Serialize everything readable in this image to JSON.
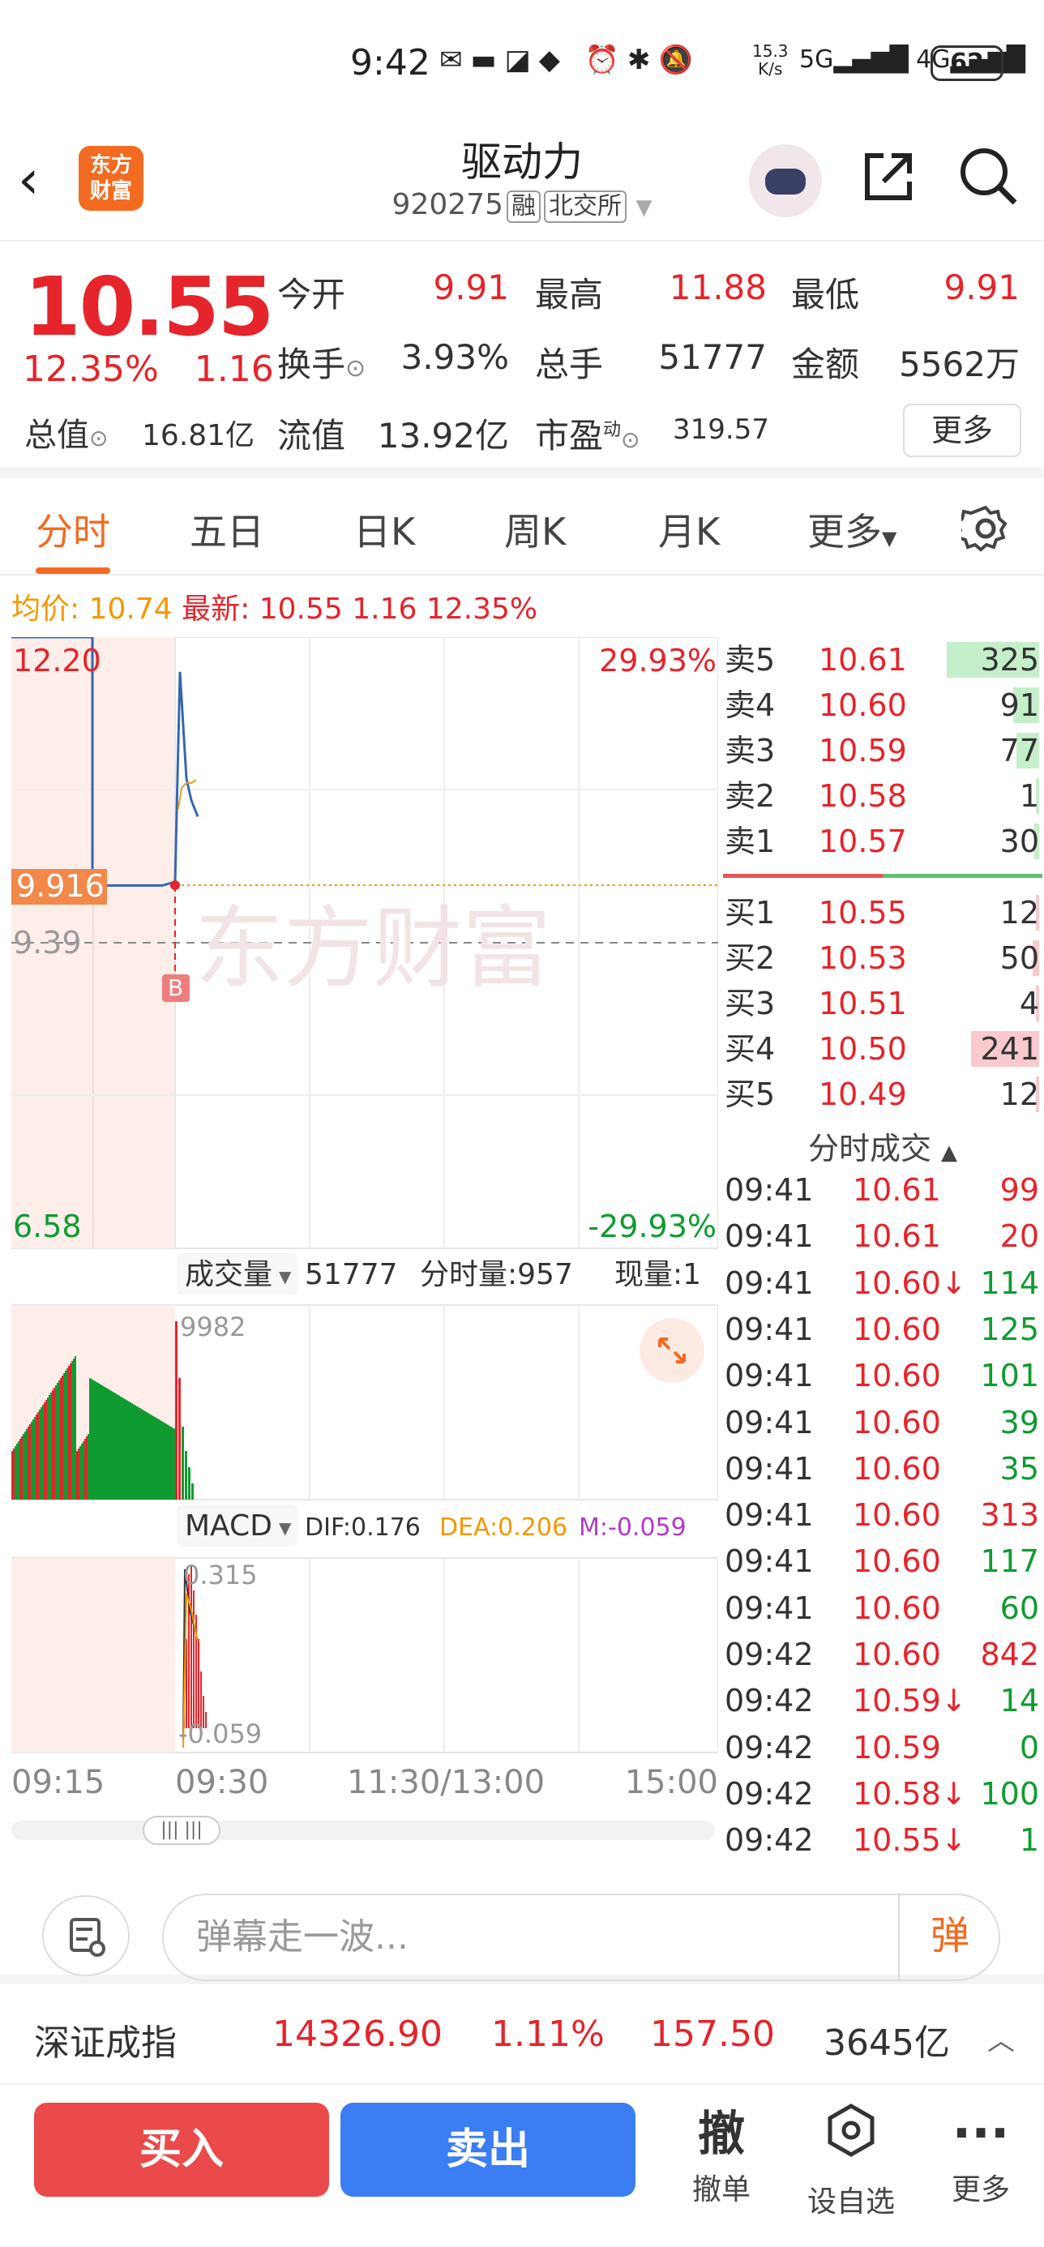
{
  "status_bar": {
    "time": "9:42",
    "net_speed_top": "15.3",
    "net_speed_bottom": "K/s",
    "signal1": "5G",
    "signal2": "4G",
    "battery": "62"
  },
  "header": {
    "title": "驱动力",
    "code": "920275",
    "tag1": "融",
    "tag2": "北交所",
    "logo_line1": "东方",
    "logo_line2": "财富"
  },
  "quote": {
    "price": "10.55",
    "change_pct": "12.35%",
    "change": "1.16",
    "open_label": "今开",
    "open": "9.91",
    "high_label": "最高",
    "high": "11.88",
    "low_label": "最低",
    "low": "9.91",
    "turnover_label": "换手",
    "turnover": "3.93%",
    "volume_label": "总手",
    "volume": "51777",
    "amount_label": "金额",
    "amount": "5562万",
    "mktcap_label": "总值",
    "mktcap": "16.81亿",
    "float_label": "流值",
    "float_cap": "13.92亿",
    "pe_label": "市盈",
    "pe_sup": "动",
    "pe": "319.57",
    "more": "更多"
  },
  "tabs": [
    "分时",
    "五日",
    "日K",
    "周K",
    "月K",
    "更多"
  ],
  "avg_line": {
    "avg_label": "均价:",
    "avg": "10.74",
    "latest_label": "最新:",
    "latest": "10.55",
    "change": "1.16",
    "pct": "12.35%"
  },
  "chart": {
    "y_high": "12.20",
    "y_low": "6.58",
    "pct_high": "29.93%",
    "pct_low": "-29.93%",
    "open_tag": "9.916",
    "prev_close": "9.39",
    "watermark": "东方财富",
    "b_marker": "B",
    "volume_label": "成交量",
    "volume_total": "51777",
    "minute_vol": "分时量:957",
    "current_vol_label": "现量:1",
    "vol_max": "9982",
    "macd_label": "MACD",
    "dif": "DIF:0.176",
    "dea": "DEA:0.206",
    "m": "M:-0.059",
    "macd_top": "0.315",
    "macd_bottom": "-0.059",
    "x_ticks": [
      "09:15",
      "09:30",
      "11:30/13:00",
      "15:00"
    ]
  },
  "chart_data": {
    "type": "line",
    "title": "",
    "x": [
      "09:15",
      "09:25",
      "09:30",
      "09:31",
      "09:32",
      "09:33",
      "09:34"
    ],
    "series": [
      {
        "values": [
          9.916,
          9.916,
          9.95,
          11.88,
          10.9,
          10.7,
          10.55
        ]
      }
    ],
    "ylim": [
      6.58,
      12.2
    ]
  },
  "order_book": {
    "asks": [
      {
        "label": "卖5",
        "price": "10.61",
        "vol": "325",
        "bar": 0.95
      },
      {
        "label": "卖4",
        "price": "10.60",
        "vol": "91",
        "bar": 0.27
      },
      {
        "label": "卖3",
        "price": "10.59",
        "vol": "77",
        "bar": 0.23
      },
      {
        "label": "卖2",
        "price": "10.58",
        "vol": "1",
        "bar": 0.01
      },
      {
        "label": "卖1",
        "price": "10.57",
        "vol": "30",
        "bar": 0.05
      }
    ],
    "bids": [
      {
        "label": "买1",
        "price": "10.55",
        "vol": "12",
        "bar": 0.03
      },
      {
        "label": "买2",
        "price": "10.53",
        "vol": "50",
        "bar": 0.07
      },
      {
        "label": "买3",
        "price": "10.51",
        "vol": "4",
        "bar": 0.01
      },
      {
        "label": "买4",
        "price": "10.50",
        "vol": "241",
        "bar": 0.7
      },
      {
        "label": "买5",
        "price": "10.49",
        "vol": "12",
        "bar": 0.03
      }
    ]
  },
  "trades": {
    "title": "分时成交",
    "rows": [
      {
        "time": "09:41",
        "price": "10.61",
        "vol": "99",
        "side": "buy"
      },
      {
        "time": "09:41",
        "price": "10.61",
        "vol": "20",
        "side": "buy"
      },
      {
        "time": "09:41",
        "price": "10.60↓",
        "vol": "114",
        "side": "sell"
      },
      {
        "time": "09:41",
        "price": "10.60",
        "vol": "125",
        "side": "sell"
      },
      {
        "time": "09:41",
        "price": "10.60",
        "vol": "101",
        "side": "sell"
      },
      {
        "time": "09:41",
        "price": "10.60",
        "vol": "39",
        "side": "sell"
      },
      {
        "time": "09:41",
        "price": "10.60",
        "vol": "35",
        "side": "sell"
      },
      {
        "time": "09:41",
        "price": "10.60",
        "vol": "313",
        "side": "buy"
      },
      {
        "time": "09:41",
        "price": "10.60",
        "vol": "117",
        "side": "sell"
      },
      {
        "time": "09:41",
        "price": "10.60",
        "vol": "60",
        "side": "sell"
      },
      {
        "time": "09:42",
        "price": "10.60",
        "vol": "842",
        "side": "buy"
      },
      {
        "time": "09:42",
        "price": "10.59↓",
        "vol": "14",
        "side": "sell"
      },
      {
        "time": "09:42",
        "price": "10.59",
        "vol": "0",
        "side": "sell"
      },
      {
        "time": "09:42",
        "price": "10.58↓",
        "vol": "100",
        "side": "sell"
      },
      {
        "time": "09:42",
        "price": "10.55↓",
        "vol": "1",
        "side": "sell"
      }
    ]
  },
  "danmu": {
    "placeholder": "弹幕走一波...",
    "button": "弹"
  },
  "index": {
    "name": "深证成指",
    "value": "14326.90",
    "pct": "1.11%",
    "change": "157.50",
    "amount": "3645亿"
  },
  "bottom": {
    "buy": "买入",
    "sell": "卖出",
    "cancel_icon": "撤",
    "cancel": "撤单",
    "watch": "设自选",
    "more": "更多"
  }
}
